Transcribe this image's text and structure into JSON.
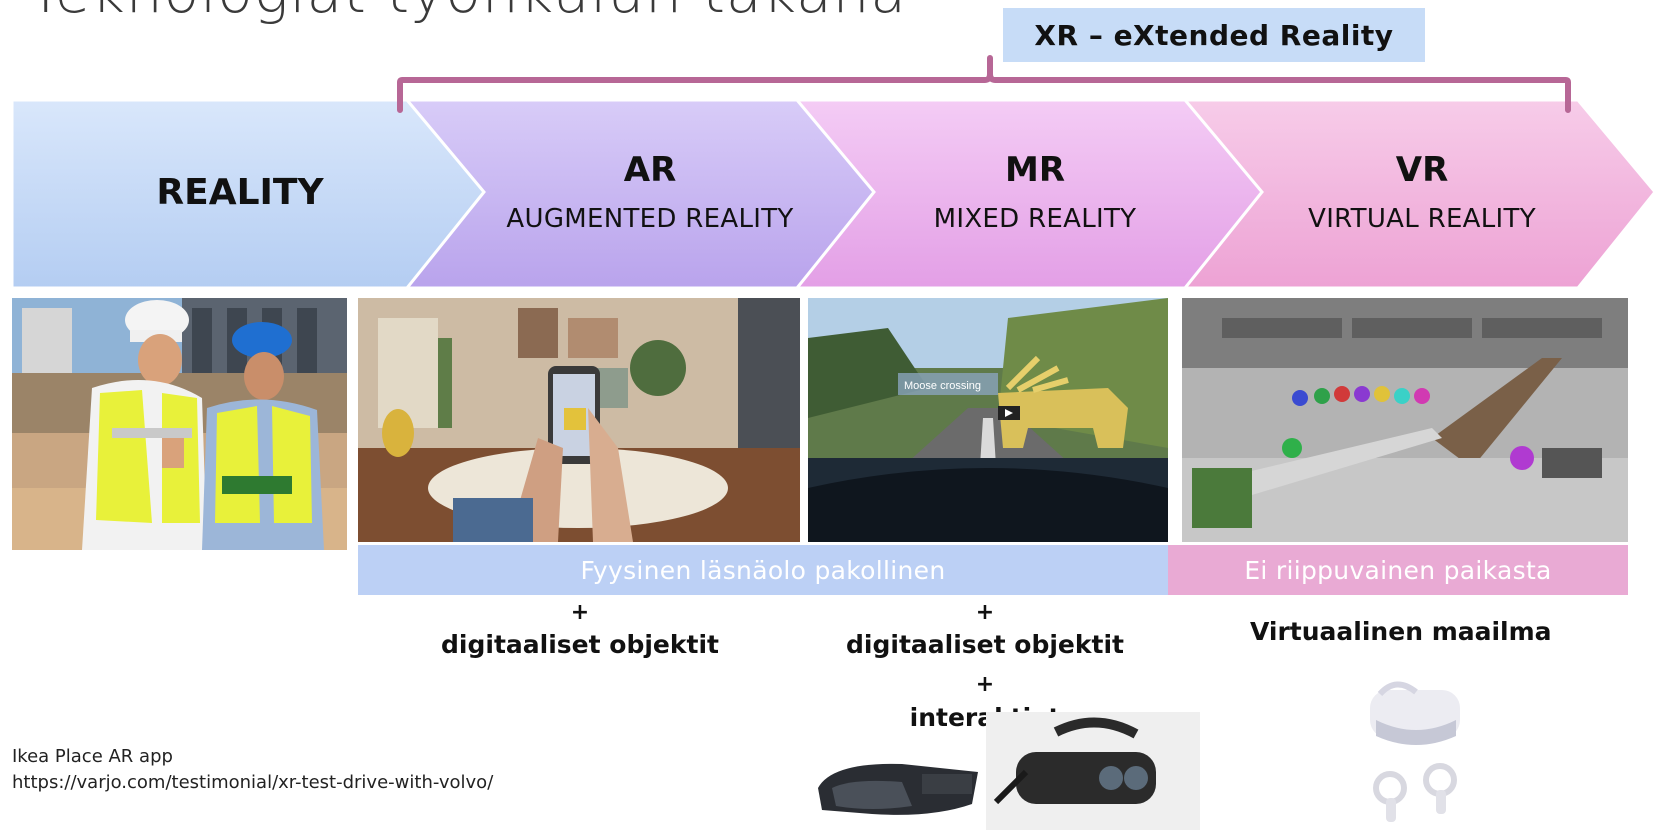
{
  "header": {
    "title": "Teknologiat työnkulun takana",
    "xr_label": "XR – eXtended Reality"
  },
  "stages": [
    {
      "title": "REALITY",
      "subtitle": ""
    },
    {
      "title": "AR",
      "subtitle": "AUGMENTED REALITY"
    },
    {
      "title": "MR",
      "subtitle": "MIXED REALITY"
    },
    {
      "title": "VR",
      "subtitle": "VIRTUAL REALITY"
    }
  ],
  "photos": {
    "mr_overlay_text": "Moose crossing"
  },
  "bars": {
    "physical": "Fyysinen läsnäolo pakollinen",
    "independent": "Ei riippuvainen paikasta"
  },
  "ar_column": {
    "plus": "+",
    "caption": "digitaaliset objektit"
  },
  "mr_column": {
    "plus1": "+",
    "caption": "digitaaliset objektit",
    "plus2": "+",
    "caption2": "interaktiot"
  },
  "vr_column": {
    "caption": "Virtuaalinen maailma"
  },
  "sources": {
    "line1": "Ikea Place AR app",
    "line2": "https://varjo.com/testimonial/xr-test-drive-with-volvo/"
  },
  "colors": {
    "reality": "#c3d8f6",
    "ar": "#c7b6f2",
    "mr": "#ecb3ee",
    "vr": "#f2b4de",
    "bracket": "#b76796",
    "bar_blue": "#b9cdf4",
    "bar_pink": "#e8a8d3"
  }
}
